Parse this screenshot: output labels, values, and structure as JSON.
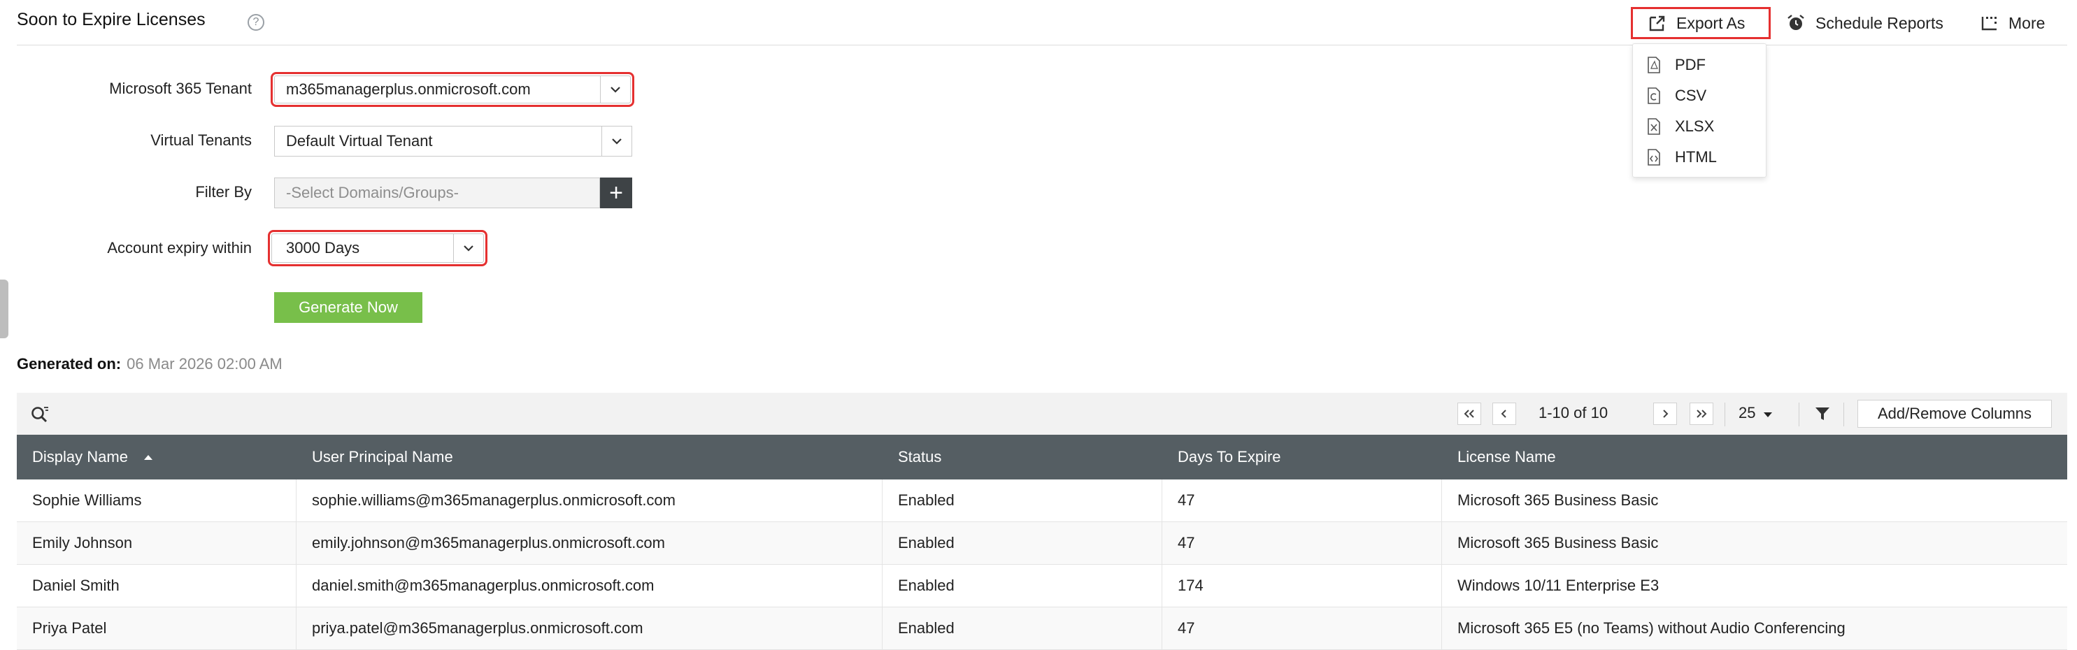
{
  "header": {
    "title": "Soon to Expire Licenses",
    "help_glyph": "?",
    "export_label": "Export As",
    "schedule_label": "Schedule Reports",
    "more_label": "More"
  },
  "export_menu": {
    "items": [
      {
        "label": "PDF",
        "icon": "pdf-file-icon"
      },
      {
        "label": "CSV",
        "icon": "csv-file-icon"
      },
      {
        "label": "XLSX",
        "icon": "xlsx-file-icon"
      },
      {
        "label": "HTML",
        "icon": "html-file-icon"
      }
    ]
  },
  "form": {
    "tenant_label": "Microsoft 365 Tenant",
    "tenant_value": "m365managerplus.onmicrosoft.com",
    "virtual_label": "Virtual Tenants",
    "virtual_value": "Default Virtual Tenant",
    "filter_label": "Filter By",
    "filter_placeholder": "-Select Domains/Groups-",
    "expiry_label": "Account expiry within",
    "expiry_value": "3000 Days",
    "generate_label": "Generate Now"
  },
  "generated": {
    "label": "Generated on:",
    "value": "06 Mar 2026 02:00 AM"
  },
  "toolbar": {
    "page_info": "1-10 of 10",
    "page_size": "25",
    "add_remove_label": "Add/Remove Columns"
  },
  "table": {
    "columns": [
      "Display Name",
      "User Principal Name",
      "Status",
      "Days To Expire",
      "License Name"
    ],
    "rows": [
      [
        "Sophie Williams",
        "sophie.williams@m365managerplus.onmicrosoft.com",
        "Enabled",
        "47",
        "Microsoft 365 Business Basic"
      ],
      [
        "Emily Johnson",
        "emily.johnson@m365managerplus.onmicrosoft.com",
        "Enabled",
        "47",
        "Microsoft 365 Business Basic"
      ],
      [
        "Daniel Smith",
        "daniel.smith@m365managerplus.onmicrosoft.com",
        "Enabled",
        "174",
        "Windows 10/11 Enterprise E3"
      ],
      [
        "Priya Patel",
        "priya.patel@m365managerplus.onmicrosoft.com",
        "Enabled",
        "47",
        "Microsoft 365 E5 (no Teams) without Audio Conferencing"
      ]
    ]
  },
  "colors": {
    "highlight": "#e53030",
    "header_bg": "#555e63",
    "generate_bg": "#78bf4a"
  }
}
